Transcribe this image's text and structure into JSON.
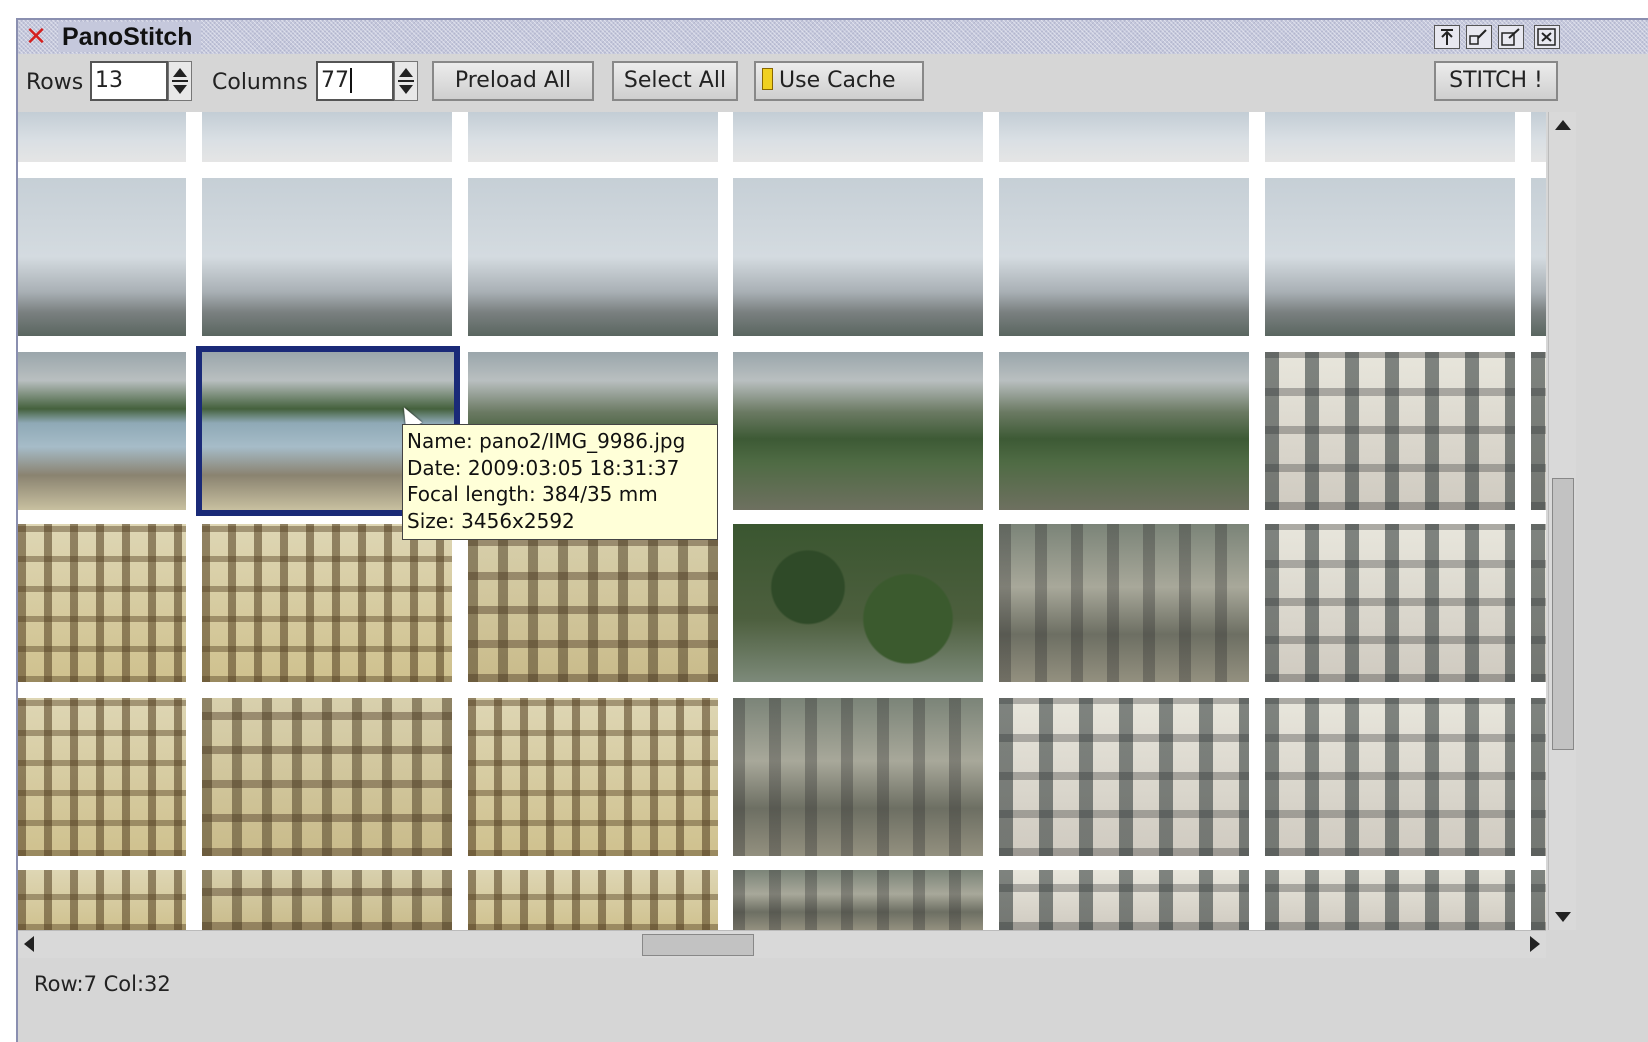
{
  "window": {
    "title": "PanoStitch"
  },
  "toolbar": {
    "rows_label": "Rows",
    "rows_value": "13",
    "columns_label": "Columns",
    "columns_value": "77",
    "preload_all": "Preload All",
    "select_all": "Select All",
    "use_cache": "Use Cache",
    "stitch": "STITCH !"
  },
  "tooltip": {
    "name": "Name: pano2/IMG_9986.jpg",
    "date": "Date: 2009:03:05 18:31:37",
    "focal": "Focal length: 384/35 mm",
    "size": "Size: 3456x2592"
  },
  "status": {
    "position": "Row:7 Col:32"
  },
  "colors": {
    "selection": "#1a2a78",
    "tooltip_bg": "#ffffd8",
    "close_icon": "#d42020"
  }
}
